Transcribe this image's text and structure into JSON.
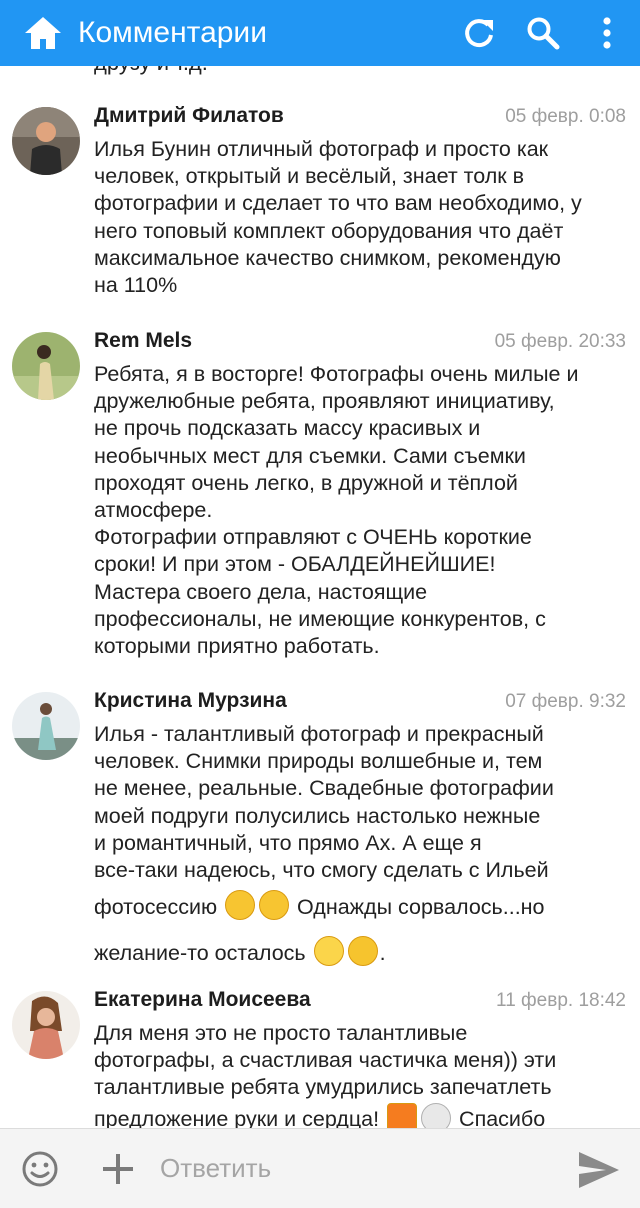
{
  "header": {
    "title": "Комментарии",
    "icons": [
      "home-icon",
      "refresh-icon",
      "search-icon",
      "more-vert-icon"
    ]
  },
  "feed": {
    "clipped_line": "друзу и т.д."
  },
  "comments": [
    {
      "author": "Дмитрий Филатов",
      "date": "05 февр. 0:08",
      "lines": [
        "Илья Бунин отличный фотограф и просто как",
        "человек, открытый и весёлый, знает толк в",
        "фотографии и сделает то что вам необходимо, у",
        "него топовый комплект оборудования что даёт",
        "максимальное качество снимком, рекомендую",
        "на 110%"
      ]
    },
    {
      "author": "Rem Mels",
      "date": "05 февр. 20:33",
      "lines": [
        "Ребята, я в восторге! Фотографы очень милые и",
        "дружелюбные ребята, проявляют инициативу,",
        "не прочь подсказать массу красивых и",
        "необычных мест для съемки. Сами съемки",
        "проходят очень легко, в дружной и тёплой",
        "атмосфере.",
        "Фотографии отправляют с ОЧЕНЬ короткие",
        "сроки! И при этом - ОБАЛДЕЙНЕЙШИЕ!",
        "Мастера своего дела, настоящие",
        "профессионалы, не имеющие конкурентов, с",
        "которыми приятно работать."
      ]
    },
    {
      "author": "Кристина Мурзина",
      "date": "07 февр. 9:32",
      "lines": [
        "Илья - талантливый фотограф и прекрасный",
        "человек. Снимки природы волшебные и, тем",
        "не менее, реальные. Свадебные фотографии",
        "моей подруги полусились настолько нежные",
        "и романтичный, что прямо Ах. А еще я",
        "все-таки надеюсь, что смогу сделать с Ильей"
      ],
      "emoji_line_1": {
        "before": "фотосессию ",
        "after": " Однажды сорвалось...но"
      },
      "emoji_line_2": {
        "before": "желание-то осталось ",
        "after": "."
      }
    },
    {
      "author": "Екатерина Моисеева",
      "date": "11 февр. 18:42",
      "lines": [
        "Для меня это не просто талантливые",
        "фотографы, а счастливая частичка меня)) эти",
        "талантливые ребята умудрились запечатлеть"
      ],
      "clipped_line": {
        "before": "предложение руки и сердца! ",
        "after": " Спасибо"
      }
    }
  ],
  "composer": {
    "placeholder": "Ответить",
    "icons": [
      "emoji-icon",
      "plus-icon",
      "send-icon"
    ]
  }
}
